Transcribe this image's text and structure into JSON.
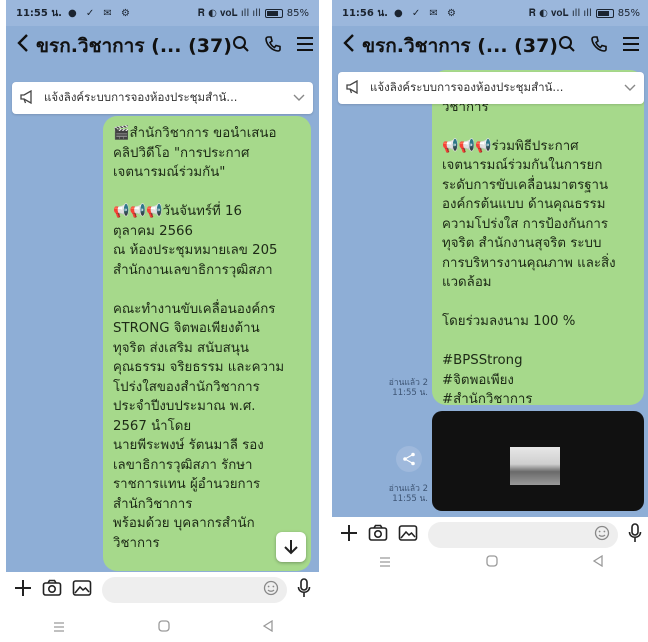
{
  "left": {
    "status": {
      "time": "11:55 น.",
      "icons_left": "● ✓ ✉ ⚙",
      "right_text": "𝐑 ◐ 𝐯𝐨𝐋 ıll ıll",
      "battery": "85%"
    },
    "header": {
      "title": "ขรก.วิชาการ (... (37)"
    },
    "announcement": "แจ้งลิงค์ระบบการจองห้องประชุมสำนั...",
    "bubble_text": "🎬สำนักวิชาการ ขอนำเสนอ\nคลิปวิดีโอ \"การประกาศ\nเจตนารมณ์ร่วมกัน\"\n\n📢📢📢วันจันทร์ที่ 16\nตุลาคม 2566\nณ ห้องประชุมหมายเลข 205\nสำนักงานเลขาธิการวุฒิสภา\n\nคณะทำงานขับเคลื่อนองค์กร\nSTRONG จิตพอเพียงต้าน\nทุจริต ส่งเสริม สนับสนุน\nคุณธรรม จริยธรรม และความ\nโปร่งใสของสำนักวิชาการ\nประจำปีงบประมาณ พ.ศ.\n2567 นำโดย\nนายพีระพงษ์ รัตนมาลี รอง\nเลขาธิการวุฒิสภา รักษา\nราชการแทน ผู้อำนวยการ\nสำนักวิชาการ\nพร้อมด้วย บุคลากรสำนัก\nวิชาการ\n\n📢📢📢ร่วมพิธีประกาศ"
  },
  "right": {
    "status": {
      "time": "11:56 น.",
      "icons_left": "● ✓ ✉ ⚙",
      "right_text": "𝐑 ◐ 𝐯𝐨𝐋 ıll ıll",
      "battery": "85%"
    },
    "header": {
      "title": "ขรก.วิชาการ (... (37)"
    },
    "announcement": "แจ้งลิงค์ระบบการจองห้องประชุมสำนั...",
    "bubble_text": "พร้อมด้วย บุคลากรสำนัก\nวิชาการ\n\n📢📢📢ร่วมพิธีประกาศ\nเจตนารมณ์ร่วมกันในการยก\nระดับการขับเคลื่อนมาตรฐาน\nองค์กรต้นแบบ ด้านคุณธรรม\nความโปร่งใส การป้องกันการ\nทุจริต สำนักงานสุจริต ระบบ\nการบริหารงานคุณภาพ และสิ่ง\nแวดล้อม\n\nโดยร่วมลงนาม 100 %\n\n#BPSStrong\n#จิตพอเพียง\n#สำนักวิชาการ\n#สำนักงานเลขาธิการวุฒิสภา",
    "meta1": {
      "read": "อ่านแล้ว 2",
      "time": "11:55 น."
    },
    "meta2": {
      "read": "อ่านแล้ว 2",
      "time": "11:55 น."
    }
  },
  "colors": {
    "chat_bg": "#8eaed6",
    "bubble": "#a6d98b",
    "header_bg": "#9bb7dc"
  }
}
